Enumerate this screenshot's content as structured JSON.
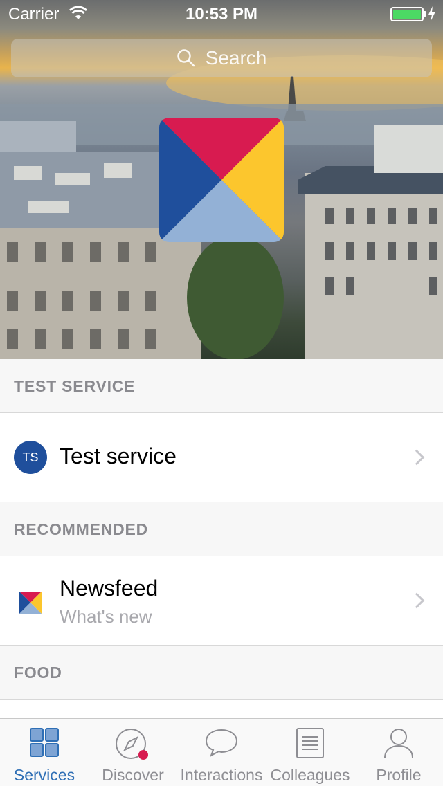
{
  "status_bar": {
    "carrier": "Carrier",
    "time": "10:53 PM"
  },
  "search": {
    "placeholder": "Search"
  },
  "sections": [
    {
      "header": "TEST SERVICE",
      "item": {
        "title": "Test service",
        "avatar_initials": "TS"
      }
    },
    {
      "header": "RECOMMENDED",
      "item": {
        "title": "Newsfeed",
        "subtitle": "What's new"
      }
    },
    {
      "header": "FOOD"
    }
  ],
  "tabbar": {
    "tabs": [
      {
        "label": "Services",
        "icon": "grid-icon",
        "active": true
      },
      {
        "label": "Discover",
        "icon": "compass-icon",
        "badge": true
      },
      {
        "label": "Interactions",
        "icon": "chat-bubble-icon"
      },
      {
        "label": "Colleagues",
        "icon": "document-list-icon"
      },
      {
        "label": "Profile",
        "icon": "person-icon"
      }
    ]
  },
  "colors": {
    "brand_red": "#d81b50",
    "brand_yellow": "#fcc62d",
    "brand_blue": "#1f4f9c",
    "brand_light_blue": "#93b1d6",
    "accent": "#2f6fb5",
    "badge": "#d81b50",
    "battery": "#4cd964"
  }
}
